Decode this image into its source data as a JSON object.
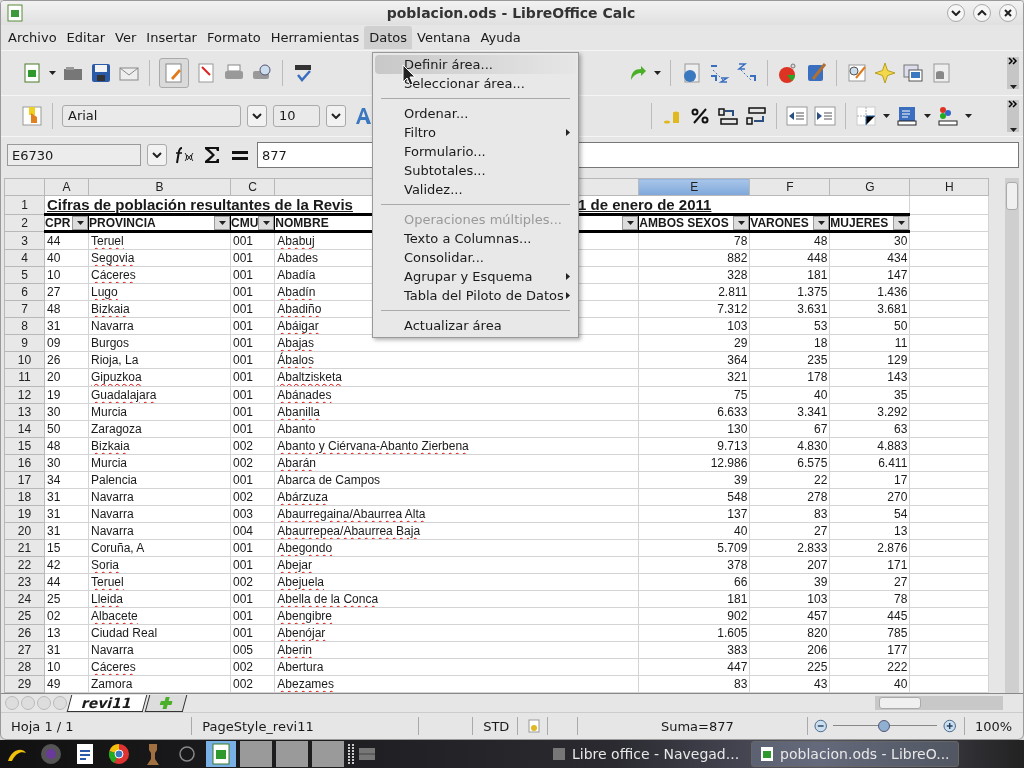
{
  "window": {
    "title": "poblacion.ods - LibreOffice Calc"
  },
  "menubar": [
    {
      "label": "Archivo",
      "selected": false
    },
    {
      "label": "Editar",
      "selected": false
    },
    {
      "label": "Ver",
      "selected": false
    },
    {
      "label": "Insertar",
      "selected": false
    },
    {
      "label": "Formato",
      "selected": false
    },
    {
      "label": "Herramientas",
      "selected": false
    },
    {
      "label": "Datos",
      "selected": true
    },
    {
      "label": "Ventana",
      "selected": false
    },
    {
      "label": "Ayuda",
      "selected": false
    }
  ],
  "format_toolbar": {
    "font": "Arial",
    "size": "10"
  },
  "formula_bar": {
    "cell_reference": "E6730",
    "value": "877"
  },
  "columns": [
    {
      "label": "A",
      "selected": false
    },
    {
      "label": "B",
      "selected": false
    },
    {
      "label": "C",
      "selected": false
    },
    {
      "selected": false
    },
    {
      "label": "E",
      "selected": true
    },
    {
      "label": "F",
      "selected": false
    },
    {
      "label": "G",
      "selected": false
    },
    {
      "label": "H",
      "selected": false
    }
  ],
  "title_row": {
    "row": "1",
    "text_left": "Cifras de población resultantes de la Revis",
    "text_right": "1 de enero de 2011"
  },
  "header_row": {
    "row": "2",
    "cells": [
      "CPR",
      "PROVINCIA",
      "CMU",
      "NOMBRE",
      "AMBOS SEXOS",
      "VARONES",
      "MUJERES"
    ]
  },
  "rows": [
    {
      "row": "3",
      "cells": [
        "44",
        "Teruel",
        "001",
        "Ababuj",
        "78",
        "48",
        "30"
      ],
      "provincia_flagged": true,
      "nombre_flagged": true
    },
    {
      "row": "4",
      "cells": [
        "40",
        "Segovia",
        "001",
        "Abades",
        "882",
        "448",
        "434"
      ],
      "provincia_flagged": true,
      "nombre_flagged": false
    },
    {
      "row": "5",
      "cells": [
        "10",
        "Cáceres",
        "001",
        "Abadía",
        "328",
        "181",
        "147"
      ],
      "provincia_flagged": true,
      "nombre_flagged": false
    },
    {
      "row": "6",
      "cells": [
        "27",
        "Lugo",
        "001",
        "Abadín",
        "2.811",
        "1.375",
        "1.436"
      ],
      "provincia_flagged": true,
      "nombre_flagged": true
    },
    {
      "row": "7",
      "cells": [
        "48",
        "Bizkaia",
        "001",
        "Abadiño",
        "7.312",
        "3.631",
        "3.681"
      ],
      "provincia_flagged": true,
      "nombre_flagged": true
    },
    {
      "row": "8",
      "cells": [
        "31",
        "Navarra",
        "001",
        "Abáigar",
        "103",
        "53",
        "50"
      ],
      "provincia_flagged": false,
      "nombre_flagged": true
    },
    {
      "row": "9",
      "cells": [
        "09",
        "Burgos",
        "001",
        "Abajas",
        "29",
        "18",
        "11"
      ],
      "provincia_flagged": false,
      "nombre_flagged": true
    },
    {
      "row": "10",
      "cells": [
        "26",
        "Rioja, La",
        "001",
        "Ábalos",
        "364",
        "235",
        "129"
      ],
      "provincia_flagged": false,
      "nombre_flagged": true
    },
    {
      "row": "11",
      "cells": [
        "20",
        "Gipuzkoa",
        "001",
        "Abaltzisketa",
        "321",
        "178",
        "143"
      ],
      "provincia_flagged": true,
      "nombre_flagged": true
    },
    {
      "row": "12",
      "cells": [
        "19",
        "Guadalajara",
        "001",
        "Abánades",
        "75",
        "40",
        "35"
      ],
      "provincia_flagged": true,
      "nombre_flagged": true
    },
    {
      "row": "13",
      "cells": [
        "30",
        "Murcia",
        "001",
        "Abanilla",
        "6.633",
        "3.341",
        "3.292"
      ],
      "provincia_flagged": false,
      "nombre_flagged": true
    },
    {
      "row": "14",
      "cells": [
        "50",
        "Zaragoza",
        "001",
        "Abanto",
        "130",
        "67",
        "63"
      ],
      "provincia_flagged": false,
      "nombre_flagged": false
    },
    {
      "row": "15",
      "cells": [
        "48",
        "Bizkaia",
        "002",
        "Abanto y Ciérvana-Abanto Zierbena",
        "9.713",
        "4.830",
        "4.883"
      ],
      "provincia_flagged": true,
      "nombre_flagged": true
    },
    {
      "row": "16",
      "cells": [
        "30",
        "Murcia",
        "002",
        "Abarán",
        "12.986",
        "6.575",
        "6.411"
      ],
      "provincia_flagged": false,
      "nombre_flagged": true
    },
    {
      "row": "17",
      "cells": [
        "34",
        "Palencia",
        "001",
        "Abarca de Campos",
        "39",
        "22",
        "17"
      ],
      "provincia_flagged": false,
      "nombre_flagged": false
    },
    {
      "row": "18",
      "cells": [
        "31",
        "Navarra",
        "002",
        "Abárzuza",
        "548",
        "278",
        "270"
      ],
      "provincia_flagged": false,
      "nombre_flagged": true
    },
    {
      "row": "19",
      "cells": [
        "31",
        "Navarra",
        "003",
        "Abaurregaina/Abaurrea Alta",
        "137",
        "83",
        "54"
      ],
      "provincia_flagged": false,
      "nombre_flagged": true
    },
    {
      "row": "20",
      "cells": [
        "31",
        "Navarra",
        "004",
        "Abaurrepea/Abaurrea Baja",
        "40",
        "27",
        "13"
      ],
      "provincia_flagged": false,
      "nombre_flagged": true
    },
    {
      "row": "21",
      "cells": [
        "15",
        "Coruña, A",
        "001",
        "Abegondo",
        "5.709",
        "2.833",
        "2.876"
      ],
      "provincia_flagged": false,
      "nombre_flagged": true
    },
    {
      "row": "22",
      "cells": [
        "42",
        "Soria",
        "001",
        "Abejar",
        "378",
        "207",
        "171"
      ],
      "provincia_flagged": true,
      "nombre_flagged": true
    },
    {
      "row": "23",
      "cells": [
        "44",
        "Teruel",
        "002",
        "Abejuela",
        "66",
        "39",
        "27"
      ],
      "provincia_flagged": true,
      "nombre_flagged": true
    },
    {
      "row": "24",
      "cells": [
        "25",
        "Lleida",
        "001",
        "Abella de la Conca",
        "181",
        "103",
        "78"
      ],
      "provincia_flagged": true,
      "nombre_flagged": true
    },
    {
      "row": "25",
      "cells": [
        "02",
        "Albacete",
        "001",
        "Abengibre",
        "902",
        "457",
        "445"
      ],
      "provincia_flagged": true,
      "nombre_flagged": true
    },
    {
      "row": "26",
      "cells": [
        "13",
        "Ciudad Real",
        "001",
        "Abenójar",
        "1.605",
        "820",
        "785"
      ],
      "provincia_flagged": false,
      "nombre_flagged": true
    },
    {
      "row": "27",
      "cells": [
        "31",
        "Navarra",
        "005",
        "Aberin",
        "383",
        "206",
        "177"
      ],
      "provincia_flagged": false,
      "nombre_flagged": true
    },
    {
      "row": "28",
      "cells": [
        "10",
        "Cáceres",
        "002",
        "Abertura",
        "447",
        "225",
        "222"
      ],
      "provincia_flagged": true,
      "nombre_flagged": false
    },
    {
      "row": "29",
      "cells": [
        "49",
        "Zamora",
        "002",
        "Abezames",
        "83",
        "43",
        "40"
      ],
      "provincia_flagged": false,
      "nombre_flagged": true
    }
  ],
  "sheet_tabs": [
    {
      "label": "revi11",
      "selected": true
    }
  ],
  "status_bar": {
    "sheet": "Hoja 1 / 1",
    "page_style": "PageStyle_revi11",
    "mode": "STD",
    "sum": "Suma=877",
    "zoom": "100%",
    "zoom_slider": {
      "level": 0.48
    }
  },
  "datos_menu": [
    {
      "kind": "item",
      "label": "Definir área...",
      "selected": true,
      "disabled": false,
      "submenu": false
    },
    {
      "kind": "item",
      "label": "Seleccionar área...",
      "selected": false,
      "disabled": false,
      "submenu": false
    },
    {
      "kind": "separator"
    },
    {
      "kind": "item",
      "label": "Ordenar...",
      "selected": false,
      "disabled": false,
      "submenu": false
    },
    {
      "kind": "item",
      "label": "Filtro",
      "selected": false,
      "disabled": false,
      "submenu": true
    },
    {
      "kind": "item",
      "label": "Formulario...",
      "selected": false,
      "disabled": false,
      "submenu": false
    },
    {
      "kind": "item",
      "label": "Subtotales...",
      "selected": false,
      "disabled": false,
      "submenu": false
    },
    {
      "kind": "item",
      "label": "Validez...",
      "selected": false,
      "disabled": false,
      "submenu": false
    },
    {
      "kind": "separator"
    },
    {
      "kind": "item",
      "label": "Operaciones múltiples...",
      "selected": false,
      "disabled": true,
      "submenu": false
    },
    {
      "kind": "item",
      "label": "Texto a Columnas...",
      "selected": false,
      "disabled": false,
      "submenu": false
    },
    {
      "kind": "item",
      "label": "Consolidar...",
      "selected": false,
      "disabled": false,
      "submenu": false
    },
    {
      "kind": "item",
      "label": "Agrupar y Esquema",
      "selected": false,
      "disabled": false,
      "submenu": true
    },
    {
      "kind": "item",
      "label": "Tabla del Piloto de Datos",
      "selected": false,
      "disabled": false,
      "submenu": true
    },
    {
      "kind": "separator"
    },
    {
      "kind": "item",
      "label": "Actualizar área",
      "selected": false,
      "disabled": false,
      "submenu": false
    }
  ],
  "taskbar": {
    "tasks": [
      {
        "label": "Libre office - Navegad...",
        "selected": false
      },
      {
        "label": "poblacion.ods - LibreO...",
        "selected": true
      }
    ]
  }
}
